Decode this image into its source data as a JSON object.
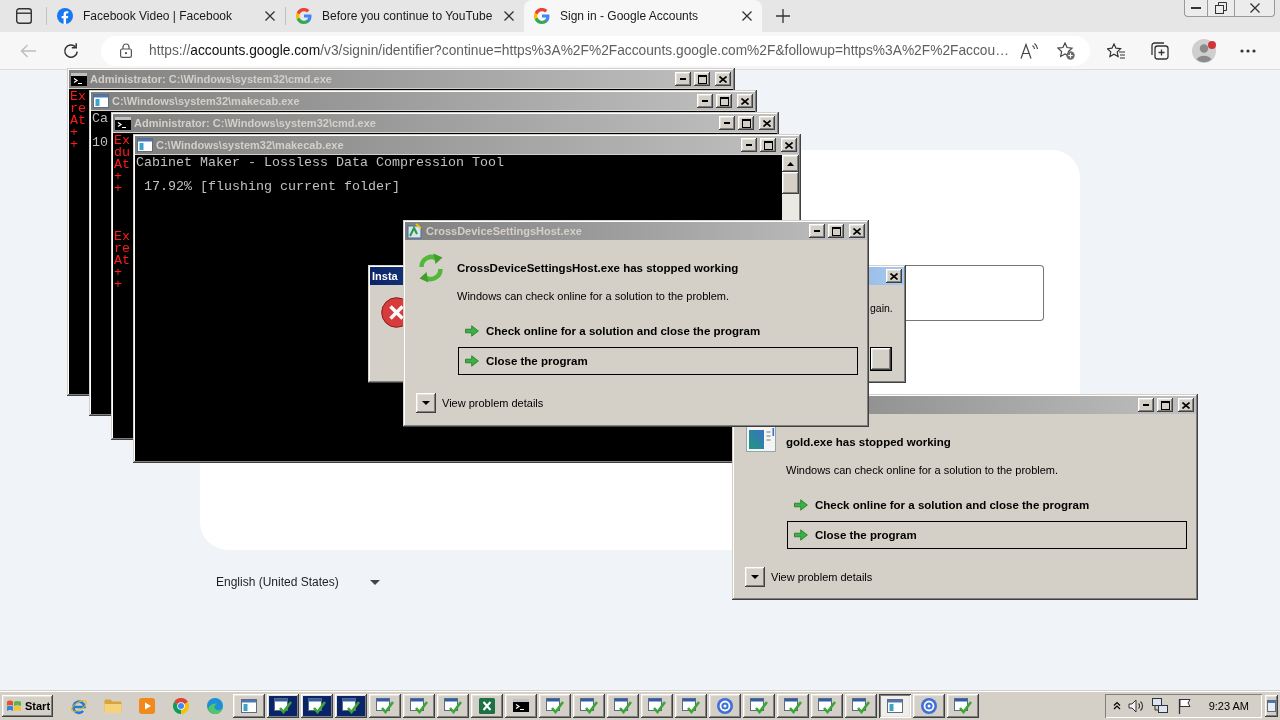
{
  "browser": {
    "tabs": [
      {
        "kind": "facebook",
        "title": "Facebook Video | Facebook",
        "selected": false
      },
      {
        "kind": "google",
        "title": "Before you continue to YouTube",
        "selected": false
      },
      {
        "kind": "google",
        "title": "Sign in - Google Accounts",
        "selected": true
      }
    ],
    "back_button": {
      "disabled": true
    },
    "address_bar": {
      "scheme": "https://",
      "host": "accounts.google.com",
      "path": "/v3/signin/identifier?continue=https%3A%2F%2Faccounts.google.com%2F&followup=https%3A%2F%2Faccou…"
    },
    "profile": {
      "notification": true
    }
  },
  "page": {
    "language": "English (United States)"
  },
  "windows": [
    {
      "kind": "cmd",
      "title": "Administrator: C:\\Windows\\system32\\cmd.exe",
      "active": false,
      "output": "Ex\nre\nAt\n+\n+",
      "error": true
    },
    {
      "kind": "console",
      "title": "C:\\Windows\\system32\\makecab.exe",
      "active": false,
      "output": "Ca\n\n10",
      "error": false
    },
    {
      "kind": "cmd",
      "title": "Administrator: C:\\Windows\\system32\\cmd.exe",
      "active": false,
      "output": "Ex\ndu\nAt\n+\n+\n\n\n\nEx\nre\nAt\n+\n+",
      "error": true
    },
    {
      "kind": "console",
      "title": "C:\\Windows\\system32\\makecab.exe",
      "active": false,
      "output": "Cabinet Maker - Lossless Data Compression Tool\n\n 17.92% [flushing current folder]",
      "error": false,
      "scrollbar": true
    },
    {
      "kind": "message",
      "title": "Insta",
      "active": true,
      "message": "gain."
    },
    {
      "kind": "crash",
      "heading_icon": {
        "kind": "window"
      },
      "active": false,
      "heading": "gold.exe has stopped working",
      "message": "Windows can check online for a solution to the problem.",
      "options": [
        {
          "label": "Check online for a solution and close the program",
          "selected": false
        },
        {
          "label": "Close the program",
          "selected": true
        }
      ],
      "details": "View problem details"
    },
    {
      "kind": "crash",
      "heading_icon": {
        "kind": "cycle"
      },
      "title": "CrossDeviceSettingsHost.exe",
      "active": false,
      "heading": "CrossDeviceSettingsHost.exe has stopped working",
      "message": "Windows can check online for a solution to the problem.",
      "options": [
        {
          "label": "Check online for a solution and close the program",
          "selected": false
        },
        {
          "label": "Close the program",
          "selected": true
        }
      ],
      "details": "View problem details"
    }
  ],
  "taskbar": {
    "start_label": "Start",
    "quick_launch": [
      {
        "kind": "ie"
      },
      {
        "kind": "folder"
      },
      {
        "kind": "media"
      },
      {
        "kind": "chrome"
      },
      {
        "kind": "edge"
      }
    ],
    "buttons": [
      {
        "kind": "window",
        "flashing": false,
        "selected": false
      },
      {
        "kind": "installer",
        "flashing": true,
        "selected": false
      },
      {
        "kind": "installer",
        "flashing": true,
        "selected": false
      },
      {
        "kind": "installer",
        "flashing": true,
        "selected": false
      },
      {
        "kind": "installer",
        "flashing": false,
        "selected": false
      },
      {
        "kind": "installer",
        "flashing": false,
        "selected": false
      },
      {
        "kind": "installer",
        "flashing": false,
        "selected": false
      },
      {
        "kind": "excel",
        "flashing": false,
        "selected": false
      },
      {
        "kind": "cmd",
        "flashing": false,
        "selected": false
      },
      {
        "kind": "installer",
        "flashing": false,
        "selected": false
      },
      {
        "kind": "installer",
        "flashing": false,
        "selected": false
      },
      {
        "kind": "installer",
        "flashing": false,
        "selected": false
      },
      {
        "kind": "installer",
        "flashing": false,
        "selected": false
      },
      {
        "kind": "installer",
        "flashing": false,
        "selected": false
      },
      {
        "kind": "disc",
        "flashing": false,
        "selected": false
      },
      {
        "kind": "installer",
        "flashing": false,
        "selected": false
      },
      {
        "kind": "installer",
        "flashing": false,
        "selected": false
      },
      {
        "kind": "installer",
        "flashing": false,
        "selected": false
      },
      {
        "kind": "installer",
        "flashing": false,
        "selected": false
      },
      {
        "kind": "window",
        "flashing": false,
        "selected": true
      },
      {
        "kind": "disc",
        "flashing": false,
        "selected": false
      },
      {
        "kind": "installer",
        "flashing": false,
        "selected": false
      }
    ],
    "clock": "9:23 AM"
  }
}
